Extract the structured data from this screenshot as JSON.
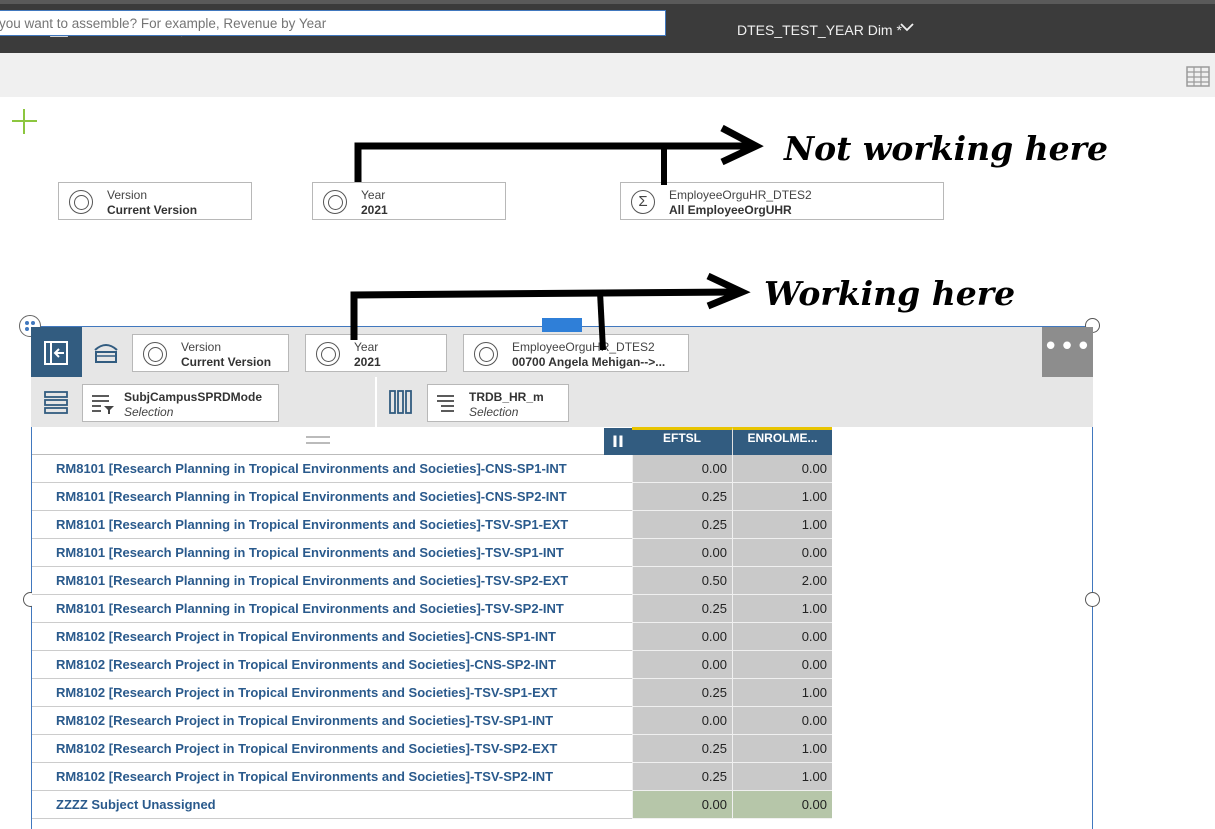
{
  "toolbar": {
    "document_title": "DTES_TEST_YEAR Dim *",
    "icons": [
      "settings-icon",
      "save-icon",
      "undo-icon",
      "redo-icon",
      "rewind-icon",
      "chevron-down-icon"
    ]
  },
  "search": {
    "placeholder": "you want to assemble? For example, Revenue by Year"
  },
  "context_filters": [
    {
      "label": "Version",
      "value": "Current Version"
    },
    {
      "label": "Year",
      "value": "2021"
    },
    {
      "label": "EmployeeOrguHR_DTES2",
      "value": "All EmployeeOrgUHR"
    }
  ],
  "annotations": {
    "top": "Not working here",
    "bottom": "Working here"
  },
  "widget": {
    "local_filters": [
      {
        "label": "Version",
        "value": "Current Version"
      },
      {
        "label": "Year",
        "value": "2021"
      },
      {
        "label": "EmployeeOrguHR_DTES2",
        "value": "00700 Angela Mehigan-->..."
      }
    ],
    "more_label": "•••",
    "rows_edge": {
      "label": "SubjCampusSPRDMode",
      "sub": "Selection"
    },
    "columns_edge": {
      "label": "TRDB_HR_m",
      "sub": "Selection"
    },
    "pause_label": "II",
    "columns": [
      "EFTSL",
      "ENROLME..."
    ],
    "rows": [
      {
        "label": "RM8101 [Research Planning in Tropical Environments and Societies]-CNS-SP1-INT",
        "v1": "0.00",
        "v2": "0.00"
      },
      {
        "label": "RM8101 [Research Planning in Tropical Environments and Societies]-CNS-SP2-INT",
        "v1": "0.25",
        "v2": "1.00"
      },
      {
        "label": "RM8101 [Research Planning in Tropical Environments and Societies]-TSV-SP1-EXT",
        "v1": "0.25",
        "v2": "1.00"
      },
      {
        "label": "RM8101 [Research Planning in Tropical Environments and Societies]-TSV-SP1-INT",
        "v1": "0.00",
        "v2": "0.00"
      },
      {
        "label": "RM8101 [Research Planning in Tropical Environments and Societies]-TSV-SP2-EXT",
        "v1": "0.50",
        "v2": "2.00"
      },
      {
        "label": "RM8101 [Research Planning in Tropical Environments and Societies]-TSV-SP2-INT",
        "v1": "0.25",
        "v2": "1.00"
      },
      {
        "label": "RM8102 [Research Project in Tropical Environments and Societies]-CNS-SP1-INT",
        "v1": "0.00",
        "v2": "0.00"
      },
      {
        "label": "RM8102 [Research Project in Tropical Environments and Societies]-CNS-SP2-INT",
        "v1": "0.00",
        "v2": "0.00"
      },
      {
        "label": "RM8102 [Research Project in Tropical Environments and Societies]-TSV-SP1-EXT",
        "v1": "0.25",
        "v2": "1.00"
      },
      {
        "label": "RM8102 [Research Project in Tropical Environments and Societies]-TSV-SP1-INT",
        "v1": "0.00",
        "v2": "0.00"
      },
      {
        "label": "RM8102 [Research Project in Tropical Environments and Societies]-TSV-SP2-EXT",
        "v1": "0.25",
        "v2": "1.00"
      },
      {
        "label": "RM8102 [Research Project in Tropical Environments and Societies]-TSV-SP2-INT",
        "v1": "0.25",
        "v2": "1.00"
      },
      {
        "label": "ZZZZ Subject Unassigned",
        "v1": "0.00",
        "v2": "0.00",
        "total": true
      }
    ]
  }
}
